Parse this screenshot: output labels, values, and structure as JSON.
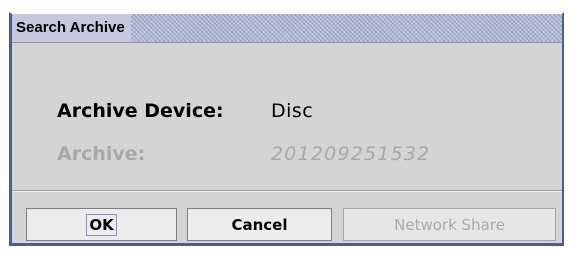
{
  "window": {
    "title": "Search Archive"
  },
  "fields": {
    "device_label": "Archive Device:",
    "device_value": "Disc",
    "archive_label": "Archive:",
    "archive_value": "201209251532"
  },
  "buttons": {
    "ok": "OK",
    "cancel": "Cancel",
    "network_share": "Network Share"
  },
  "colors": {
    "border": "#4d5d8e",
    "dialog_bg": "#d4d4d4",
    "disabled_text": "#a8a8a8"
  }
}
